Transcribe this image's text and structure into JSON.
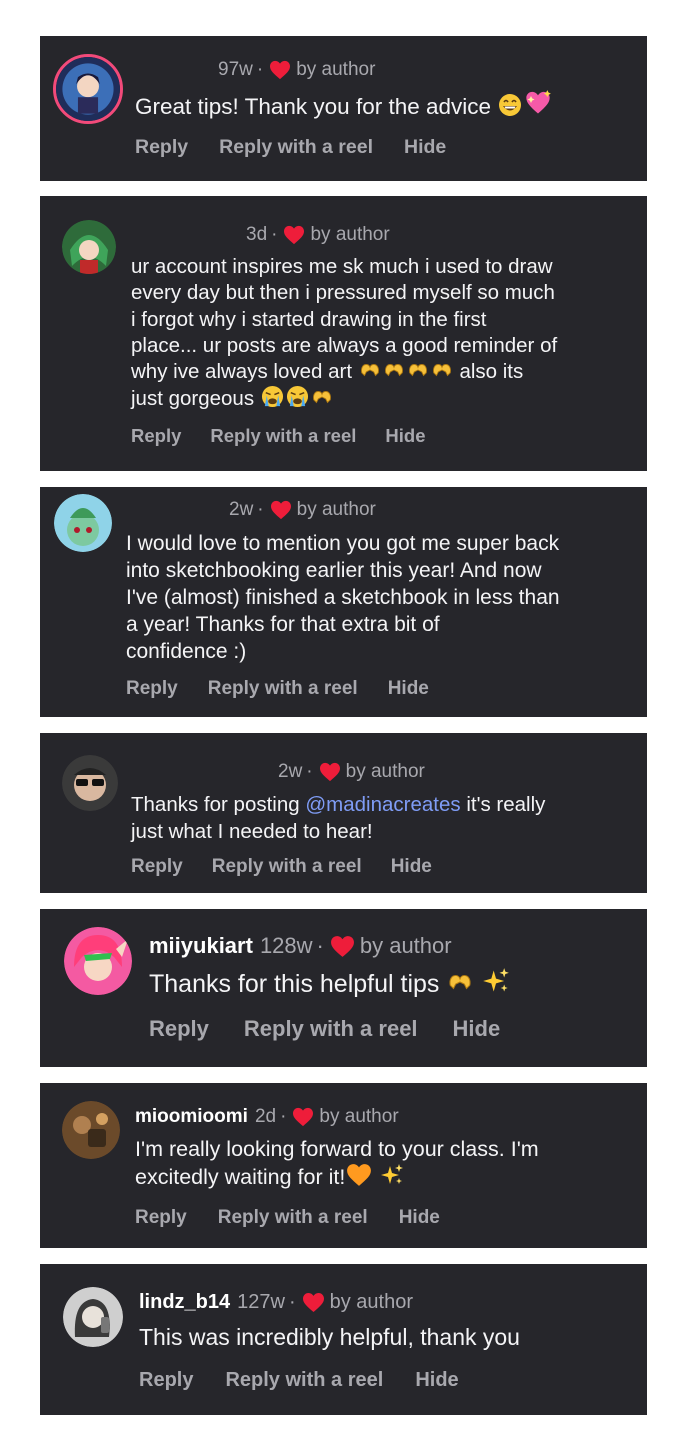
{
  "colors": {
    "card_bg": "#26262b",
    "heart": "#ee1d3a",
    "mention": "#7f9cf5",
    "muted": "#a8a8ae"
  },
  "comments": [
    {
      "username": "",
      "time": "97w",
      "dot": "·",
      "liked_by": "by author",
      "text": "Great tips! Thank you for the advice",
      "emojis": [
        "grinning-face",
        "sparkling-heart"
      ],
      "actions": [
        "Reply",
        "Reply with a reel",
        "Hide"
      ]
    },
    {
      "username": "",
      "time": "3d",
      "dot": "·",
      "liked_by": "by author",
      "lines": [
        "ur account inspires me sk much i used to draw",
        "every day but then i pressured myself so much",
        "i forgot why i started drawing in the first",
        "place... ur posts are always a good reminder of",
        "why ive always loved art",
        "also its",
        "just gorgeous"
      ],
      "emojis": [
        "heart-hands",
        "heart-hands",
        "heart-hands",
        "heart-hands",
        "loudly-crying-face",
        "loudly-crying-face",
        "heart-hands"
      ],
      "actions": [
        "Reply",
        "Reply with a reel",
        "Hide"
      ]
    },
    {
      "username": "",
      "time": "2w",
      "dot": "·",
      "liked_by": "by author",
      "lines": [
        "I would love to mention you got me super back",
        "into sketchbooking earlier this year! And now",
        "I've (almost) finished a sketchbook in less than",
        "a year! Thanks for that extra bit of",
        "confidence :)"
      ],
      "actions": [
        "Reply",
        "Reply with a reel",
        "Hide"
      ]
    },
    {
      "username": "",
      "time": "2w",
      "dot": "·",
      "liked_by": "by author",
      "text_before": "Thanks for posting ",
      "mention": "@madinacreates",
      "text_after": " it's really",
      "line2": "just what I needed to hear!",
      "actions": [
        "Reply",
        "Reply with a reel",
        "Hide"
      ]
    },
    {
      "username": "miiyukiart",
      "time": "128w",
      "dot": "·",
      "liked_by": "by author",
      "text": "Thanks for this helpful tips",
      "emojis": [
        "heart-hands",
        "sparkles"
      ],
      "actions": [
        "Reply",
        "Reply with a reel",
        "Hide"
      ]
    },
    {
      "username": "mioomioomi",
      "time": "2d",
      "dot": "·",
      "liked_by": "by author",
      "lines": [
        "I'm really looking forward to your class. I'm",
        "excitedly waiting for it!"
      ],
      "emojis": [
        "orange-heart",
        "sparkles"
      ],
      "actions": [
        "Reply",
        "Reply with a reel",
        "Hide"
      ]
    },
    {
      "username": "lindz_b14",
      "time": "127w",
      "dot": "·",
      "liked_by": "by author",
      "text": "This was incredibly helpful, thank you",
      "actions": [
        "Reply",
        "Reply with a reel",
        "Hide"
      ]
    }
  ]
}
